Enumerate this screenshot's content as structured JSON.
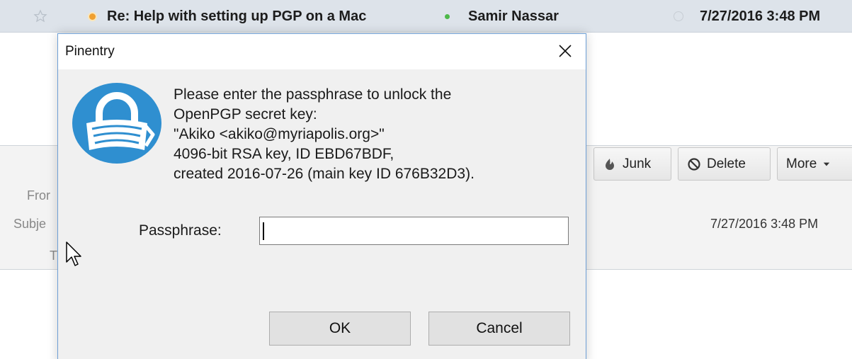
{
  "mail": {
    "message_row": {
      "subject": "Re: Help with setting up PGP on a Mac",
      "sender": "Samir Nassar",
      "date": "7/27/2016 3:48 PM"
    },
    "header": {
      "buttons": {
        "junk": "Junk",
        "delete": "Delete",
        "more": "More"
      },
      "labels": {
        "from": "Fror",
        "subject": "Subje",
        "to": "T"
      },
      "date": "7/27/2016 3:48 PM"
    }
  },
  "dialog": {
    "title": "Pinentry",
    "prompt_lines": [
      "Please enter the passphrase to unlock the",
      "OpenPGP secret key:",
      "\"Akiko <akiko@myriapolis.org>\"",
      "4096-bit RSA key, ID EBD67BDF,",
      "created 2016-07-26 (main key ID 676B32D3)."
    ],
    "passphrase_label": "Passphrase:",
    "passphrase_value": "",
    "ok_label": "OK",
    "cancel_label": "Cancel"
  },
  "icons": {
    "star": "star-icon",
    "thread": "thread-dot-icon",
    "status": "online-status-icon",
    "clock": "clock-icon",
    "junk": "junk-flame-icon",
    "delete": "prohibited-icon",
    "more": "chevron-down-icon",
    "close": "close-icon",
    "lock": "lock-logo-icon",
    "cursor": "mouse-pointer-icon"
  },
  "colors": {
    "lock_blue": "#2f8fd0",
    "row_background": "#dde3ea",
    "dialog_border": "#6d9fd6"
  }
}
